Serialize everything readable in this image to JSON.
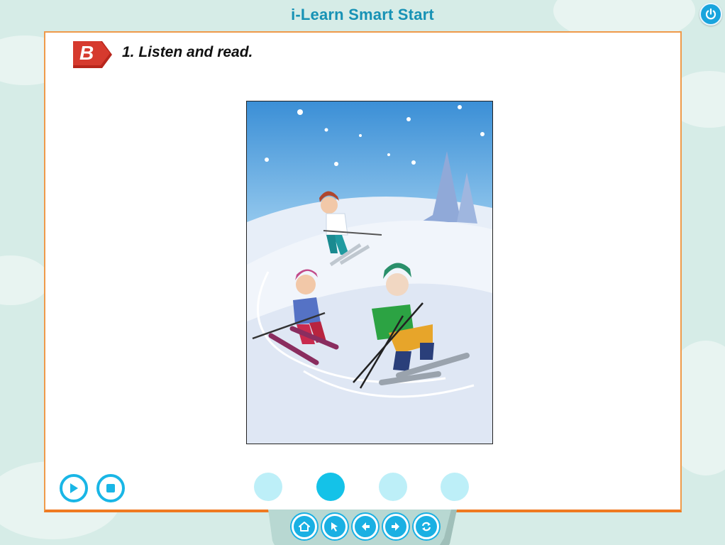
{
  "app": {
    "title": "i-Learn Smart Start"
  },
  "header": {
    "power_icon": "power-icon"
  },
  "exercise": {
    "badge": "B",
    "instruction": "1. Listen and read."
  },
  "illustration": {
    "subject": "skiing-scene"
  },
  "audio_controls": {
    "play_icon": "play-icon",
    "stop_icon": "stop-icon"
  },
  "pagination": {
    "total": 4,
    "active_index": 2
  },
  "nav": {
    "buttons": [
      "home-icon",
      "cursor-icon",
      "previous-icon",
      "next-icon",
      "refresh-icon"
    ]
  },
  "colors": {
    "title": "#1792b5",
    "panel_border": "#ef9a4a",
    "badge": "#d63a2e",
    "accent": "#19b6e6",
    "dot_inactive": "#bdeff8",
    "dot_active": "#14c2e8",
    "background": "#d6ece7"
  }
}
